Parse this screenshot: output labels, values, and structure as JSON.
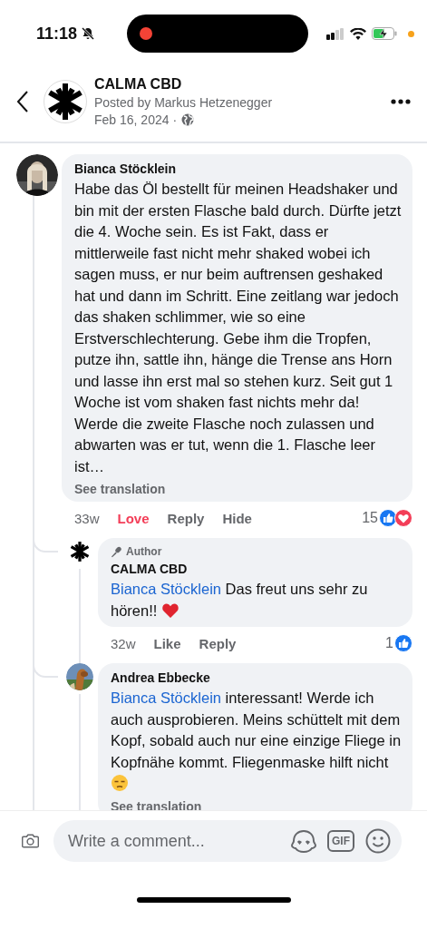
{
  "status_bar": {
    "time": "11:18",
    "silent": true,
    "recording": true,
    "charging": true
  },
  "header": {
    "page_name": "CALMA CBD",
    "posted_by": "Posted by Markus Hetzenegger",
    "date": "Feb 16, 2024 ·"
  },
  "comments": [
    {
      "avatar": {
        "kind": "picture"
      },
      "author": "Bianca Stöcklein",
      "text": "Habe das Öl bestellt für meinen Headshaker und bin mit der ersten Flasche bald durch. Dürfte jetzt die 4. Woche sein. Es ist Fakt, dass er mittlerweile fast nicht mehr shaked wobei ich sagen muss, er nur beim auftrensen geshaked hat und dann im Schritt. Eine zeitlang war jedoch das shaken schlimmer, wie so eine Erstverschlechterung. Gebe ihm die Tropfen, putze ihn, sattle ihn, hänge die Trense ans Horn und lasse ihn erst mal so stehen kurz. Seit gut 1 Woche ist vom shaken fast nichts mehr da! Werde die zweite Flasche noch zulassen und abwarten was er tut, wenn die 1. Flasche leer ist…",
      "see_translation": "See translation",
      "time": "33w",
      "actions": [
        {
          "label": "Love",
          "selected": true
        },
        {
          "label": "Reply",
          "selected": false
        },
        {
          "label": "Hide",
          "selected": false
        }
      ],
      "reaction_count": "15",
      "reactions": [
        {
          "kind": "like"
        },
        {
          "kind": "love"
        }
      ],
      "replies": [
        {
          "avatar": {
            "kind": "logo"
          },
          "author": "CALMA CBD",
          "badge": "Author",
          "mention": "Bianca Stöcklein",
          "text": "Das freut uns sehr zu hören!!",
          "emoji": {
            "kind": "heart"
          },
          "time": "32w",
          "actions": [
            {
              "label": "Like",
              "selected": false
            },
            {
              "label": "Reply",
              "selected": false
            }
          ],
          "reaction_count": "1",
          "reactions": [
            {
              "kind": "like"
            }
          ]
        },
        {
          "avatar": {
            "kind": "picture"
          },
          "author": "Andrea Ebbecke",
          "mention": "Bianca Stöcklein",
          "text": "interessant! Werde ich auch ausprobieren. Meins schüttelt mit dem Kopf, sobald auch nur eine einzige Fliege in Kopfnähe kommt. Fliegenmaske hilft nicht",
          "emoji": {
            "kind": "unamused"
          },
          "see_translation": "See translation"
        }
      ]
    }
  ],
  "composer": {
    "placeholder": "Write a comment...",
    "gif_label": "GIF"
  }
}
